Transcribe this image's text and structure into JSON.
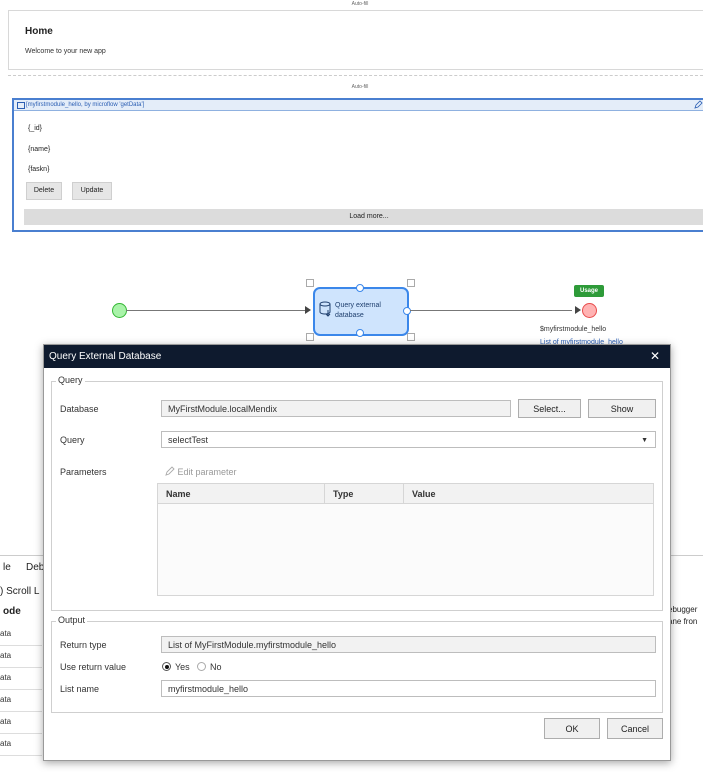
{
  "page_editor": {
    "autofill_label_1": "Auto-fill",
    "home_title": "Home",
    "home_text": "Welcome to your new app",
    "autofill_label_2": "Auto-fill",
    "listview_source": "[myfirstmodule_hello, by microflow 'getData']",
    "field_id": "{_id}",
    "field_name": "{name}",
    "field_faskn": "{faskn}",
    "delete_button": "Delete",
    "update_button": "Update",
    "load_more": "Load more..."
  },
  "microflow": {
    "activity_label": "Query external database",
    "usage_badge": "Usage",
    "end_param_name": "$myfirstmodule_hello",
    "end_param_link": "List of myfirstmodule_hello"
  },
  "bottom_pane": {
    "tab_1": "le",
    "tab_2": "Debu",
    "scroll_text": ") Scroll L",
    "col_header": "ode",
    "rows": [
      "ata",
      "ata",
      "ata",
      "ata",
      "ata",
      "ata"
    ],
    "right_text_1": "ebugger",
    "right_text_2": "ane fron"
  },
  "dialog": {
    "title": "Query External Database",
    "close_glyph": "✕",
    "query_group": "Query",
    "database_label": "Database",
    "database_value": "MyFirstModule.localMendix",
    "select_button": "Select...",
    "show_button": "Show",
    "query_label": "Query",
    "query_value": "selectTest",
    "parameters_label": "Parameters",
    "edit_parameter": "Edit parameter",
    "param_columns": [
      "Name",
      "Type",
      "Value"
    ],
    "output_group": "Output",
    "return_type_label": "Return type",
    "return_type_value": "List of MyFirstModule.myfirstmodule_hello",
    "use_return_label": "Use return value",
    "use_return_yes": "Yes",
    "use_return_no": "No",
    "use_return_selected": "Yes",
    "list_name_label": "List name",
    "list_name_value": "myfirstmodule_hello",
    "ok_button": "OK",
    "cancel_button": "Cancel"
  }
}
